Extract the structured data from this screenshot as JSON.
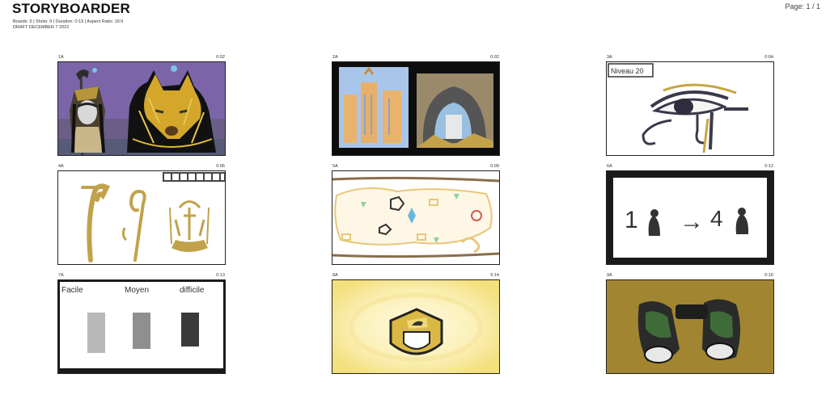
{
  "header": {
    "title": "STORYBOARDER",
    "meta_line": "Boards: 9  |  Shots: 9  |  Duration: 0:19  |  Aspect Ratio: 16:9",
    "date_line": "DRAFT DECEMBER 7 2022",
    "page_label": "Page: 1 / 1"
  },
  "panels": [
    {
      "id": "1A",
      "time": "0:02"
    },
    {
      "id": "2A",
      "time": "0:02"
    },
    {
      "id": "3A",
      "time": "0:04"
    },
    {
      "id": "4A",
      "time": "0:06"
    },
    {
      "id": "5A",
      "time": "0:09"
    },
    {
      "id": "6A",
      "time": "0:12"
    },
    {
      "id": "7A",
      "time": "0:13"
    },
    {
      "id": "8A",
      "time": "0:14"
    },
    {
      "id": "9A",
      "time": "0:16"
    }
  ],
  "drawings": {
    "level_text": "Niveau 20",
    "numbers_left": "1",
    "numbers_right": "4",
    "arrow": "→",
    "difficulty": [
      "Facile",
      "Moyen",
      "difficile"
    ]
  }
}
